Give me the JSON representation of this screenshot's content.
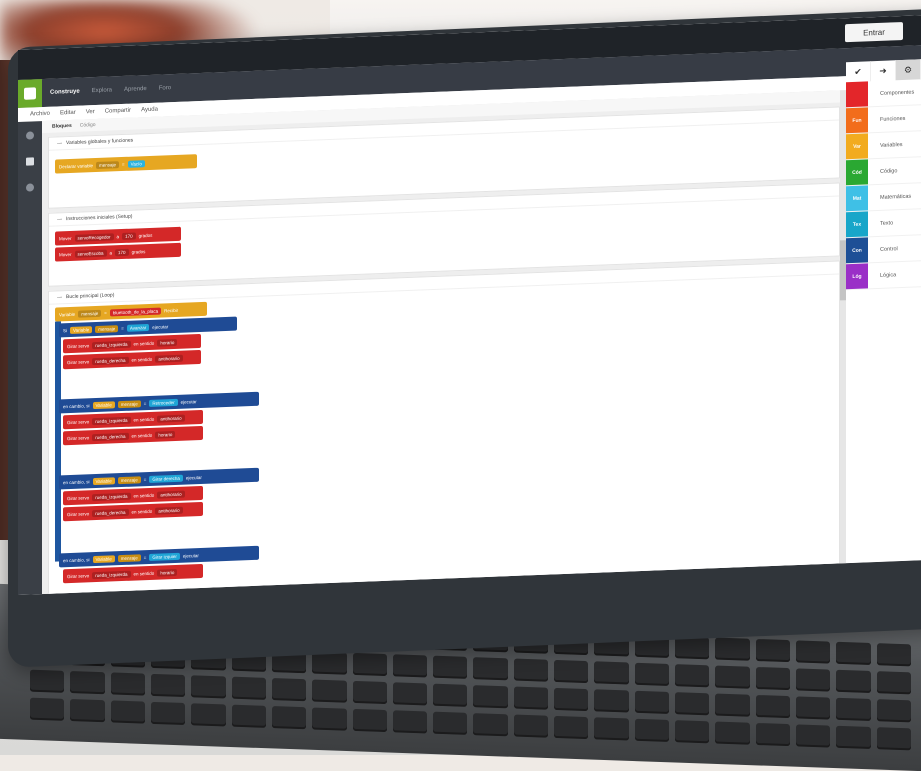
{
  "header": {
    "login_label": "Entrar",
    "nav": [
      "Construye",
      "Explora",
      "Aprende",
      "Foro"
    ]
  },
  "menu": [
    "Archivo",
    "Editar",
    "Ver",
    "Compartir",
    "Ayuda"
  ],
  "editor_tabs": [
    "Bloques",
    "Código"
  ],
  "panels": {
    "globals_title": "Variables globales y funciones",
    "setup_title": "Instrucciones iniciales (Setup)",
    "loop_title": "Bucle principal (Loop)"
  },
  "blocks": {
    "declare": {
      "label": "Declarar variable",
      "name": "mensaje",
      "eq": "=",
      "value": "Vacío"
    },
    "move1": {
      "label": "Mover",
      "servo": "servoRecogedor",
      "eq": "a",
      "value": "170",
      "unit": "grados"
    },
    "move2": {
      "label": "Mover",
      "servo": "servoEscoba",
      "eq": "a",
      "value": "170",
      "unit": "grados"
    },
    "assign": {
      "label": "Variable",
      "name": "mensaje",
      "eq": "=",
      "source": "bluetooth_de_la_placa",
      "action": "Recibir"
    },
    "if1": {
      "label": "Si",
      "var": "Variable",
      "name": "mensaje",
      "op": "=",
      "value": "Avanzar",
      "run": "ejecutar"
    },
    "rot1a": {
      "label": "Girar servo",
      "servo": "rueda_izquierda",
      "dir_lbl": "en sentido",
      "dir": "horario"
    },
    "rot1b": {
      "label": "Girar servo",
      "servo": "rueda_derecha",
      "dir_lbl": "en sentido",
      "dir": "antihorario"
    },
    "elif1": {
      "label": "en cambio, si",
      "var": "Variable",
      "name": "mensaje",
      "op": "=",
      "value": "Retroceder",
      "run": "ejecutar"
    },
    "rot2a": {
      "label": "Girar servo",
      "servo": "rueda_izquierda",
      "dir_lbl": "en sentido",
      "dir": "antihorario"
    },
    "rot2b": {
      "label": "Girar servo",
      "servo": "rueda_derecha",
      "dir_lbl": "en sentido",
      "dir": "horario"
    },
    "elif2": {
      "label": "en cambio, si",
      "var": "Variable",
      "name": "mensaje",
      "op": "=",
      "value": "Girar derecha",
      "run": "ejecutar"
    },
    "rot3a": {
      "label": "Girar servo",
      "servo": "rueda_izquierda",
      "dir_lbl": "en sentido",
      "dir": "antihorario"
    },
    "rot3b": {
      "label": "Girar servo",
      "servo": "rueda_derecha",
      "dir_lbl": "en sentido",
      "dir": "antihorario"
    },
    "elif3": {
      "label": "en cambio, si",
      "var": "Variable",
      "name": "mensaje",
      "op": "=",
      "value": "Girar izquier",
      "run": "ejecutar"
    },
    "rot4a": {
      "label": "Girar servo",
      "servo": "rueda_izquierda",
      "dir_lbl": "en sentido",
      "dir": "horario"
    }
  },
  "toolbox": {
    "head_icons": [
      "check-icon",
      "arrow-right-icon",
      "gear-icon"
    ],
    "categories": [
      {
        "abbr": "",
        "label": "Componentes",
        "color": "#e3262a"
      },
      {
        "abbr": "Fun",
        "label": "Funciones",
        "color": "#f26d1b"
      },
      {
        "abbr": "Var",
        "label": "Variables",
        "color": "#f2ab1f"
      },
      {
        "abbr": "Cód",
        "label": "Código",
        "color": "#2aa832"
      },
      {
        "abbr": "Mat",
        "label": "Matemáticas",
        "color": "#3fc0e6"
      },
      {
        "abbr": "Tex",
        "label": "Texto",
        "color": "#18a6c9"
      },
      {
        "abbr": "Con",
        "label": "Control",
        "color": "#1d4f96"
      },
      {
        "abbr": "Lóg",
        "label": "Lógica",
        "color": "#9a2fc7"
      }
    ]
  }
}
